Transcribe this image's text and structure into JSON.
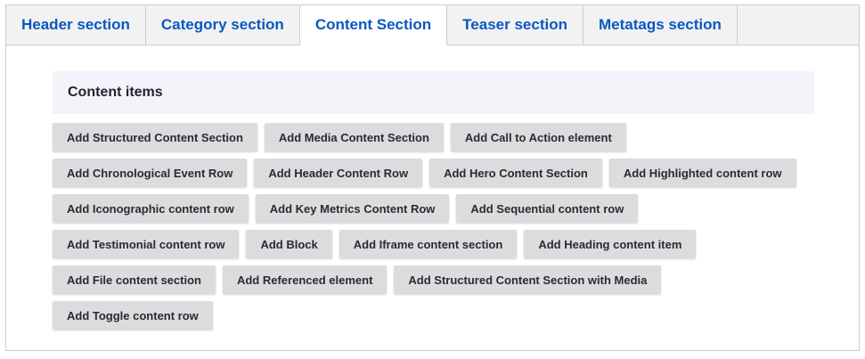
{
  "tabs": [
    {
      "label": "Header section",
      "active": false
    },
    {
      "label": "Category section",
      "active": false
    },
    {
      "label": "Content Section",
      "active": true
    },
    {
      "label": "Teaser section",
      "active": false
    },
    {
      "label": "Metatags section",
      "active": false
    }
  ],
  "content_items": {
    "title": "Content items",
    "buttons": [
      "Add Structured Content Section",
      "Add Media Content Section",
      "Add Call to Action element",
      "Add Chronological Event Row",
      "Add Header Content Row",
      "Add Hero Content Section",
      "Add Highlighted content row",
      "Add Iconographic content row",
      "Add Key Metrics Content Row",
      "Add Sequential content row",
      "Add Testimonial content row",
      "Add Block",
      "Add Iframe content section",
      "Add Heading content item",
      "Add File content section",
      "Add Referenced element",
      "Add Structured Content Section with Media",
      "Add Toggle content row"
    ]
  },
  "colors": {
    "tab_text": "#0a58c2",
    "tabbar_bg": "#f2f2f2",
    "panel_header_bg": "#f3f4f9",
    "button_bg": "#dcdcde"
  }
}
